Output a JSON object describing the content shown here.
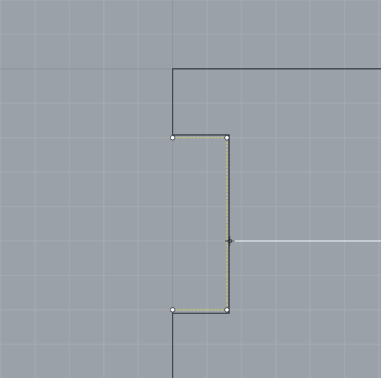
{
  "viewport": {
    "background_color": "#9ba1a8",
    "grid_color": "#a8aeb5",
    "axis_color": "#8b9097",
    "curve_color": "#2d3037",
    "selection_color": "#d6d25a",
    "edge_highlight_color": "#c8d8b8",
    "control_point_fill": "#ffffff",
    "control_point_stroke": "#2d3037",
    "guide_line_color": "#e6ebf0",
    "cursor_icon": "crosshair-cursor-icon"
  }
}
